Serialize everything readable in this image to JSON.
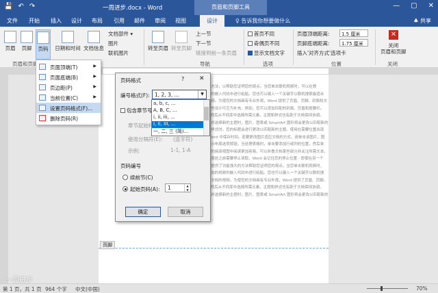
{
  "titlebar": {
    "qat_save": "💾",
    "qat_undo": "↶",
    "qat_redo": "↷",
    "doc_title": "一周进步.docx - Word",
    "hf_tools": "页眉和页脚工具",
    "min": "—",
    "max": "▢",
    "close": "✕"
  },
  "tabs": [
    "文件",
    "开始",
    "插入",
    "设计",
    "布局",
    "引用",
    "邮件",
    "审阅",
    "视图",
    "设计"
  ],
  "tellme": "♀ 告诉我你想要做什么",
  "share": "♣ 共享",
  "ribbon": {
    "header_btn": "页眉",
    "footer_btn": "页脚",
    "pagenum_btn": "页码",
    "datetime_btn": "日期和时间",
    "docinfo_btn": "文档信息",
    "docparts": "文档部件 ▾",
    "picture": "图片",
    "onlinepic": "联机图片",
    "goto_header": "转至页眉",
    "goto_footer": "转至页脚",
    "prev": "上一节",
    "next": "下一节",
    "link_prev": "链接到前一条页眉",
    "diff_first": "首页不同",
    "diff_oddeven": "奇偶页不同",
    "show_doctext": "显示文档文字",
    "hdr_top_label": "页眉顶端距离:",
    "hdr_top_val": "1.5 厘米",
    "ftr_bottom_label": "页脚底端距离:",
    "ftr_bottom_val": "1.75 厘米",
    "align_tab": "插入'对齐方式'选项卡",
    "close_label": "关闭\n页眉和页脚",
    "group_hf": "页眉和页脚",
    "group_nav": "导航",
    "group_opts": "选项",
    "group_pos": "位置",
    "group_close": "关闭"
  },
  "pnmenu": {
    "items": [
      {
        "label": "页面顶端(T)",
        "has_arrow": true
      },
      {
        "label": "页面底端(B)",
        "has_arrow": true
      },
      {
        "label": "页边距(P)",
        "has_arrow": true
      },
      {
        "label": "当前位置(C)",
        "has_arrow": true
      },
      {
        "label": "设置页码格式(F)...",
        "has_arrow": false
      },
      {
        "label": "删除页码(R)",
        "has_arrow": false
      }
    ]
  },
  "dialog": {
    "title": "页码格式",
    "help": "?",
    "close": "✕",
    "format_label": "编号格式(F):",
    "format_value": "1, 2, 3, ...",
    "include_chapter": "包含章节号",
    "chapter_style": "章节起始样式",
    "separator_label": "使用分隔符(E):",
    "separator_value": "(连字符)",
    "example_label": "示例:",
    "example_value": "1-1, 1-A",
    "numbering_section": "页码编号",
    "continue": "续前节(C)",
    "start_at": "起始页码(A):",
    "start_value": "1",
    "ok": "确定",
    "cancel": "取消"
  },
  "format_options": [
    "a, b, c, ...",
    "A, B, C, ...",
    "i, ii, iii, ...",
    "I, II, III, ...",
    "一, 二, 三 (简)..."
  ],
  "doc_lines": [
    "...供了强有力的方法，以帮助您证明您的观点。当您单击联机视频时，可以在想",
    "...要添加的视频的嵌入代码中进行粘贴。您也可以键入一个关键字以联机搜索最适合",
    "...您的文档的视频。为使您的文档具有专业外观，Word 提供了页眉、页脚、封面和文",
    "...本框设计，这些设计可互为补充。例如，您可以添加匹配的封面、页眉和提要栏。",
    "...单击\"插入\"，然后从不同库中选择所需元素。主题和样式也有助于文档保持协调。",
    "...当您单击设计并选择新的主题时，图片、图表或 SmartArt 图形将会更改以匹配新的",
    "...主题。当应用样式时，您的标题会进行更改以匹配新的主题。使用在需要位置出现",
    "...的新按钮在 Word 中保存时间。若要更改图片适应文档的方式，请单击该图片，图",
    "...片旁边将会显示布局选项按钮。当处理表格时，单击要添加行或列的位置，然后单",
    "...击加号。在新的阅读视图中阅读更加容易。可以折叠文档某些部分并关注所需文本。",
    "...如果在达到结尾处之前需要停止读取，Word 会记住您的停止位置 - 即使在另一个",
    "...设备上。视频提供了功能强大的方法帮助您证明您的观点。当您单击联机视频时，",
    "...可以在想要添加的视频的嵌入代码中进行粘贴。您也可以键入一个关键字以联机搜",
    "...索最适合您的文档的视频。为使您的文档具有专业外观，Word 提供了页眉、页脚。",
    "...单击\"插入\"，然后从不同库中选择所需元素。主题和样式也有助于文档保持协调。",
    "...当您单击设计并选择新的主题时，图片、图表或 SmartArt 图形将会更改以匹配新的"
  ],
  "header_tag": "页脚",
  "status": {
    "pages": "第 1 页，共 1 页",
    "words": "964 个字",
    "lang": "中文(中国)",
    "zoom": "70%",
    "zoom_level": 0.7
  },
  "watermark": "一周进步"
}
